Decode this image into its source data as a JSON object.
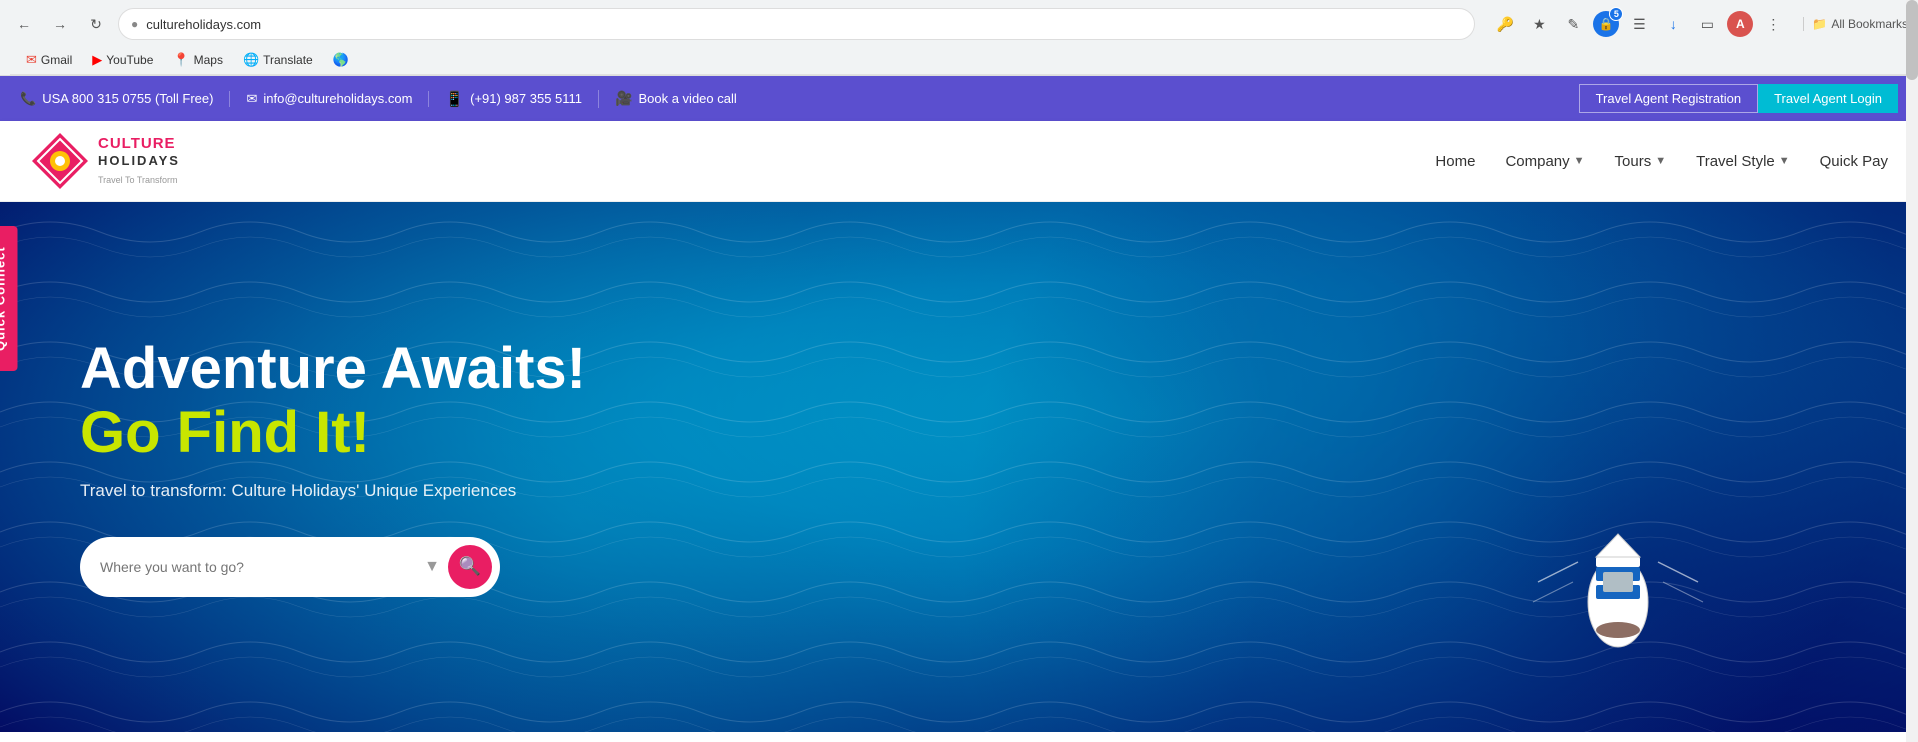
{
  "browser": {
    "url": "cultureholidays.com",
    "back_btn": "←",
    "forward_btn": "→",
    "refresh_btn": "↺",
    "star_icon": "★",
    "pen_icon": "✏",
    "all_bookmarks_label": "All Bookmarks"
  },
  "bookmarks_bar": {
    "items": [
      {
        "id": "gmail",
        "icon": "✉",
        "label": "Gmail",
        "color": "#EA4335"
      },
      {
        "id": "youtube",
        "icon": "▶",
        "label": "YouTube",
        "color": "#FF0000"
      },
      {
        "id": "maps",
        "icon": "📍",
        "label": "Maps",
        "color": "#34A853"
      },
      {
        "id": "translate",
        "icon": "🌐",
        "label": "Translate",
        "color": "#4285F4"
      },
      {
        "id": "globe",
        "icon": "🌍",
        "label": "",
        "color": "#4285F4"
      }
    ]
  },
  "top_bar": {
    "phone": "USA 800 315 0755 (Toll Free)",
    "email": "info@cultureholidays.com",
    "whatsapp": "(+91) 987 355 5111",
    "video_call": "Book a video call",
    "agent_registration": "Travel Agent Registration",
    "agent_login": "Travel Agent Login"
  },
  "header": {
    "logo_name_top": "CULTURE",
    "logo_name_bottom": "HOLIDAYS",
    "logo_tagline": "Travel To Transform",
    "nav_items": [
      {
        "id": "home",
        "label": "Home",
        "has_dropdown": false
      },
      {
        "id": "company",
        "label": "Company",
        "has_dropdown": true
      },
      {
        "id": "tours",
        "label": "Tours",
        "has_dropdown": true
      },
      {
        "id": "travel-style",
        "label": "Travel Style",
        "has_dropdown": true
      },
      {
        "id": "quick-pay",
        "label": "Quick Pay",
        "has_dropdown": false
      }
    ]
  },
  "hero": {
    "title_part1": "Adventure Awaits!",
    "title_part2": "Go Find It!",
    "subtitle": "Travel to transform: Culture Holidays' Unique Experiences",
    "search_placeholder": "Where you want to go?",
    "search_btn_icon": "🔍"
  },
  "quick_connect": {
    "label": "Quick Connect"
  }
}
